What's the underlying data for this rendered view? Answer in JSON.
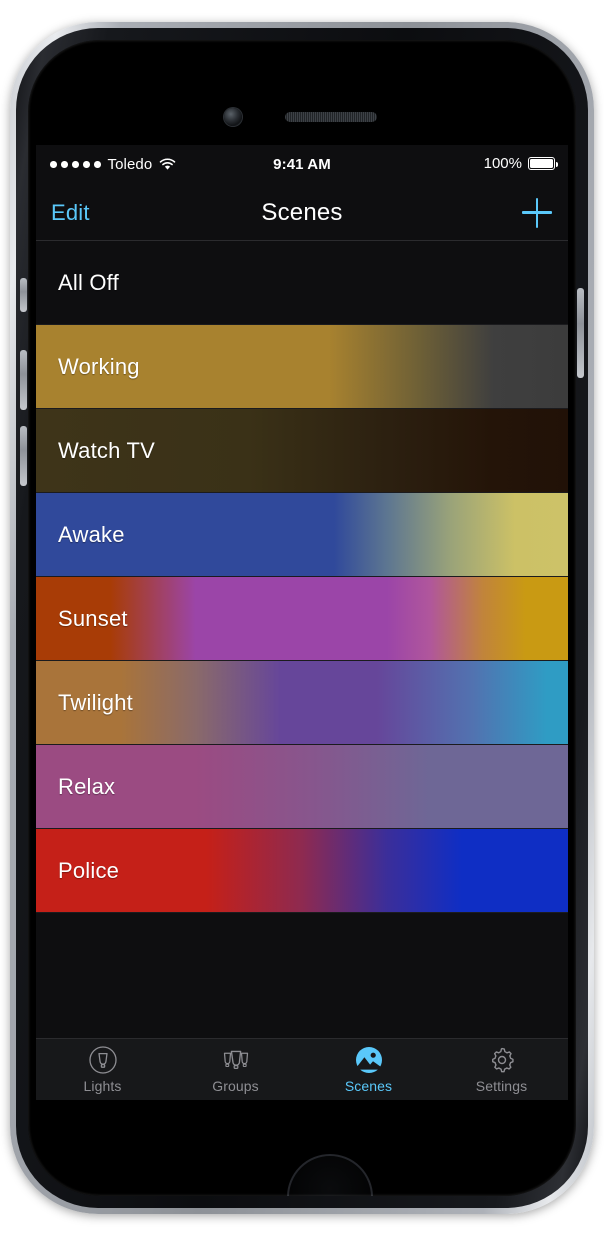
{
  "device": {
    "frame": "iphone",
    "components": [
      "front-camera",
      "earpiece-speaker",
      "home-button",
      "mute-switch",
      "volume-up",
      "volume-down",
      "power-button"
    ]
  },
  "status_bar": {
    "signal_dots": 5,
    "carrier": "Toledo",
    "wifi_icon": "wifi-icon",
    "time": "9:41 AM",
    "battery_percent": "100%",
    "battery_level": 100
  },
  "nav_bar": {
    "edit_label": "Edit",
    "title": "Scenes",
    "add_icon": "plus-icon"
  },
  "scenes": [
    {
      "name": "All Off",
      "gradient": "linear-gradient(90deg,#0e0e10 0%,#0e0e10 100%)"
    },
    {
      "name": "Working",
      "gradient": "linear-gradient(90deg,#a8822f 0%,#a8822f 55%,#6e6036 72%,#3f3f3f 86%,#3c3c3c 100%)"
    },
    {
      "name": "Watch TV",
      "gradient": "linear-gradient(90deg,#3e3419 0%,#3a3117 40%,#2c2010 66%,#241408 86%,#211107 100%)"
    },
    {
      "name": "Awake",
      "gradient": "linear-gradient(90deg,#30499b 0%,#30499b 56%,#5d7691 66%,#9aa379 78%,#ccc166 90%,#cdc268 100%)"
    },
    {
      "name": "Sunset",
      "gradient": "linear-gradient(90deg,#a83c06 0%,#a83c06 14%,#9b45a8 30%,#9b45a8 66%,#b0569c 74%,#c1843b 84%,#c99a13 92%,#c99a13 100%)"
    },
    {
      "name": "Twilight",
      "gradient": "linear-gradient(90deg,#a9743a 0%,#a9743a 16%,#8a6a6a 30%,#66469a 46%,#66469a 64%,#5272b0 82%,#2f9cc4 96%,#2f9cc4 100%)"
    },
    {
      "name": "Relax",
      "gradient": "linear-gradient(90deg,#9b4b82 0%,#9b4b82 30%,#87568d 52%,#6e6796 74%,#6e6796 100%)"
    },
    {
      "name": "Police",
      "gradient": "linear-gradient(90deg,#c52018 0%,#c52018 32%,#8e2a50 50%,#3b2e9a 66%,#0f2ec4 80%,#0f2ec4 100%)"
    }
  ],
  "tab_bar": {
    "active_tab": "Scenes",
    "accent_color": "#5ac8fa",
    "inactive_color": "#8e8e93",
    "tabs": [
      {
        "label": "Lights",
        "icon": "bulb-circle-icon",
        "active": false
      },
      {
        "label": "Groups",
        "icon": "bulb-group-icon",
        "active": false
      },
      {
        "label": "Scenes",
        "icon": "scene-photo-icon",
        "active": true
      },
      {
        "label": "Settings",
        "icon": "gear-icon",
        "active": false
      }
    ]
  }
}
